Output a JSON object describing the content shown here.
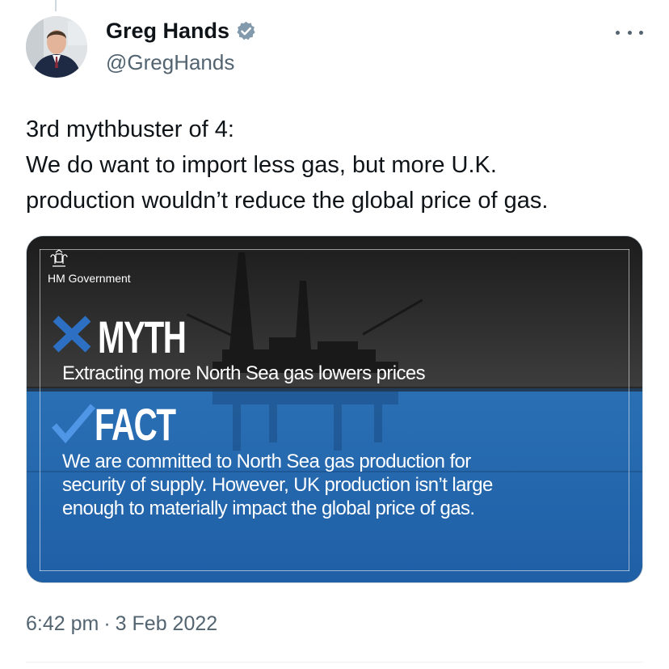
{
  "author": {
    "name": "Greg Hands",
    "handle": "@GregHands",
    "verified": true,
    "avatar_icon": "profile-photo"
  },
  "more_icon": "more-horizontal-icon",
  "tweet": {
    "lines": [
      "3rd mythbuster of 4:",
      "We do want to import less gas, but more U.K.",
      "production wouldn’t reduce the global price of gas."
    ]
  },
  "media": {
    "org_label": "HM Government",
    "myth": {
      "label": "MYTH",
      "text": "Extracting more North Sea gas lowers prices"
    },
    "fact": {
      "label": "FACT",
      "lines": [
        "We are committed to North Sea gas production for",
        "security of supply. However, UK production isn’t large",
        "enough to materially impact the global price of gas."
      ]
    },
    "colors": {
      "top_panel": "#2e2e2e",
      "bottom_panel": "#2a66a8",
      "myth_x": "#2d6fc2",
      "fact_tick": "#4f96e6"
    }
  },
  "meta": {
    "time": "6:42 pm",
    "separator": "·",
    "date": "3 Feb 2022"
  },
  "colors": {
    "text_primary": "#0f1419",
    "text_secondary": "#536471",
    "verified_badge": "#829aab"
  }
}
